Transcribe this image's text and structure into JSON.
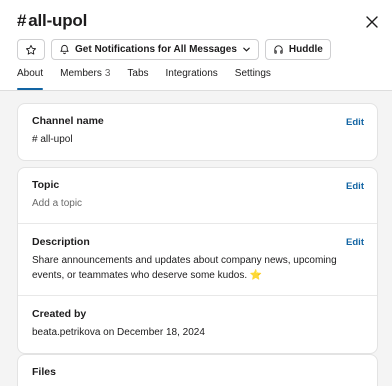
{
  "channel": {
    "name": "all-upol",
    "hash": "#"
  },
  "toolbar": {
    "notifications_label": "Get Notifications for All Messages",
    "huddle_label": "Huddle"
  },
  "tabs": [
    {
      "label": "About",
      "count": ""
    },
    {
      "label": "Members",
      "count": "3"
    },
    {
      "label": "Tabs",
      "count": ""
    },
    {
      "label": "Integrations",
      "count": ""
    },
    {
      "label": "Settings",
      "count": ""
    }
  ],
  "about": {
    "channel_name_label": "Channel name",
    "channel_name_value": "# all-upol",
    "topic_label": "Topic",
    "topic_value": "Add a topic",
    "description_label": "Description",
    "description_value": "Share announcements and updates about company news, upcoming events, or teammates who deserve some kudos. ⭐",
    "created_by_label": "Created by",
    "created_by_value": "beata.petrikova on December 18, 2024",
    "files_label": "Files",
    "edit_label": "Edit"
  },
  "colors": {
    "accent": "#1264a3",
    "background": "#f4f4f4"
  }
}
